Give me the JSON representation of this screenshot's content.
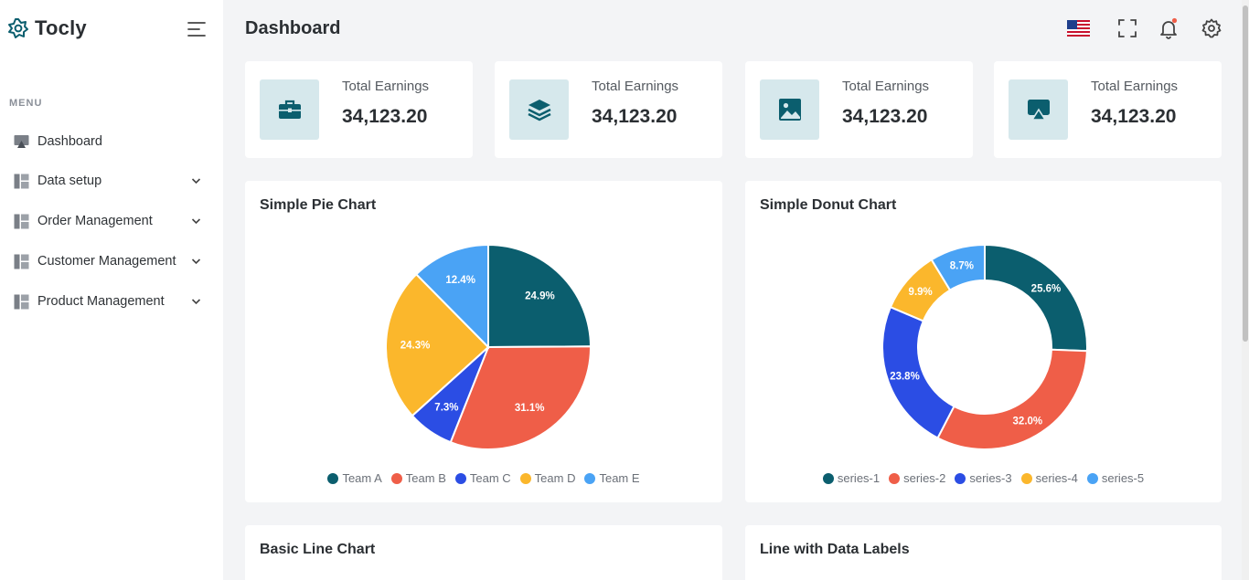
{
  "brand": {
    "name": "Tocly",
    "color": "#0b5e6e"
  },
  "sidebar": {
    "menu_heading": "MENU",
    "items": [
      {
        "label": "Dashboard",
        "icon": "monitor-icon",
        "has_submenu": false
      },
      {
        "label": "Data setup",
        "icon": "layout-icon",
        "has_submenu": true
      },
      {
        "label": "Order Management",
        "icon": "layout-icon",
        "has_submenu": true
      },
      {
        "label": "Customer Management",
        "icon": "layout-icon",
        "has_submenu": true
      },
      {
        "label": "Product Management",
        "icon": "layout-icon",
        "has_submenu": true
      }
    ]
  },
  "header": {
    "title": "Dashboard",
    "icons": [
      "us-flag-icon",
      "fullscreen-icon",
      "bell-icon",
      "gear-icon"
    ]
  },
  "stats": [
    {
      "label": "Total Earnings",
      "value": "34,123.20",
      "icon": "briefcase-icon"
    },
    {
      "label": "Total Earnings",
      "value": "34,123.20",
      "icon": "layers-icon"
    },
    {
      "label": "Total Earnings",
      "value": "34,123.20",
      "icon": "image-icon"
    },
    {
      "label": "Total Earnings",
      "value": "34,123.20",
      "icon": "airplay-icon"
    }
  ],
  "cards": {
    "pie_title": "Simple Pie Chart",
    "donut_title": "Simple Donut Chart",
    "line_title": "Basic Line Chart",
    "line_labels_title": "Line with Data Labels"
  },
  "chart_data": [
    {
      "type": "pie",
      "title": "Simple Pie Chart",
      "categories": [
        "Team A",
        "Team B",
        "Team C",
        "Team D",
        "Team E"
      ],
      "values": [
        24.9,
        31.1,
        7.3,
        24.3,
        12.4
      ],
      "labels": [
        "24.9%",
        "31.1%",
        "7.3%",
        "24.3%",
        "12.4%"
      ],
      "colors": [
        "#0b5e6e",
        "#ef5e48",
        "#2b4de4",
        "#fbb72c",
        "#4aa3f5"
      ],
      "legend": "bottom"
    },
    {
      "type": "pie",
      "title": "Simple Donut Chart",
      "donut": true,
      "categories": [
        "series-1",
        "series-2",
        "series-3",
        "series-4",
        "series-5"
      ],
      "values": [
        25.6,
        32.0,
        23.8,
        9.9,
        8.7
      ],
      "labels": [
        "25.6%",
        "32.0%",
        "23.8%",
        "9.9%",
        "8.7%"
      ],
      "colors": [
        "#0b5e6e",
        "#ef5e48",
        "#2b4de4",
        "#fbb72c",
        "#4aa3f5"
      ],
      "legend": "bottom"
    }
  ]
}
